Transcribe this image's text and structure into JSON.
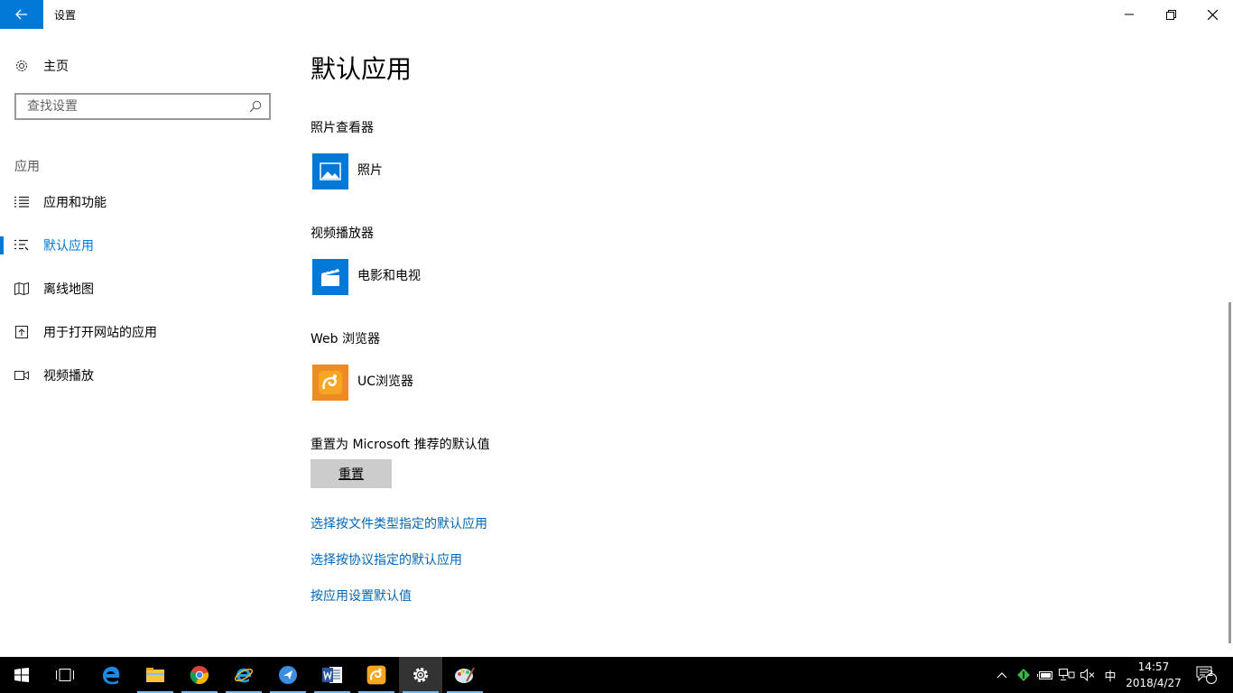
{
  "window": {
    "title": "设置",
    "back_icon": "arrow-left-icon",
    "minimize_icon": "minimize-icon",
    "restore_icon": "restore-icon",
    "close_icon": "close-icon"
  },
  "sidebar": {
    "home_label": "主页",
    "search_placeholder": "查找设置",
    "section_label": "应用",
    "items": [
      {
        "label": "应用和功能",
        "icon": "list-icon",
        "active": false
      },
      {
        "label": "默认应用",
        "icon": "default-apps-icon",
        "active": true
      },
      {
        "label": "离线地图",
        "icon": "map-icon",
        "active": false
      },
      {
        "label": "用于打开网站的应用",
        "icon": "open-site-icon",
        "active": false
      },
      {
        "label": "视频播放",
        "icon": "video-icon",
        "active": false
      }
    ]
  },
  "main": {
    "title": "默认应用",
    "groups": [
      {
        "label": "照片查看器",
        "app": "照片",
        "icon": "photos-icon",
        "color": "#0078d7"
      },
      {
        "label": "视频播放器",
        "app": "电影和电视",
        "icon": "movies-tv-icon",
        "color": "#0078d7"
      },
      {
        "label": "Web 浏览器",
        "app": "UC浏览器",
        "icon": "uc-browser-icon",
        "color": "#f08a24"
      }
    ],
    "reset_label": "重置为 Microsoft 推荐的默认值",
    "reset_button": "重置",
    "links": [
      "选择按文件类型指定的默认应用",
      "选择按协议指定的默认应用",
      "按应用设置默认值"
    ]
  },
  "taskbar": {
    "apps": [
      "start-icon",
      "task-view-icon",
      "edge-icon",
      "file-explorer-icon",
      "chrome-icon",
      "ie-icon",
      "feishu-icon",
      "word-icon",
      "uc-browser-icon",
      "settings-icon",
      "paint-icon"
    ],
    "ime": "中",
    "time": "14:57",
    "date": "2018/4/27",
    "notification_count": "2"
  },
  "colors": {
    "accent": "#0078d7",
    "link": "#0067b8"
  }
}
